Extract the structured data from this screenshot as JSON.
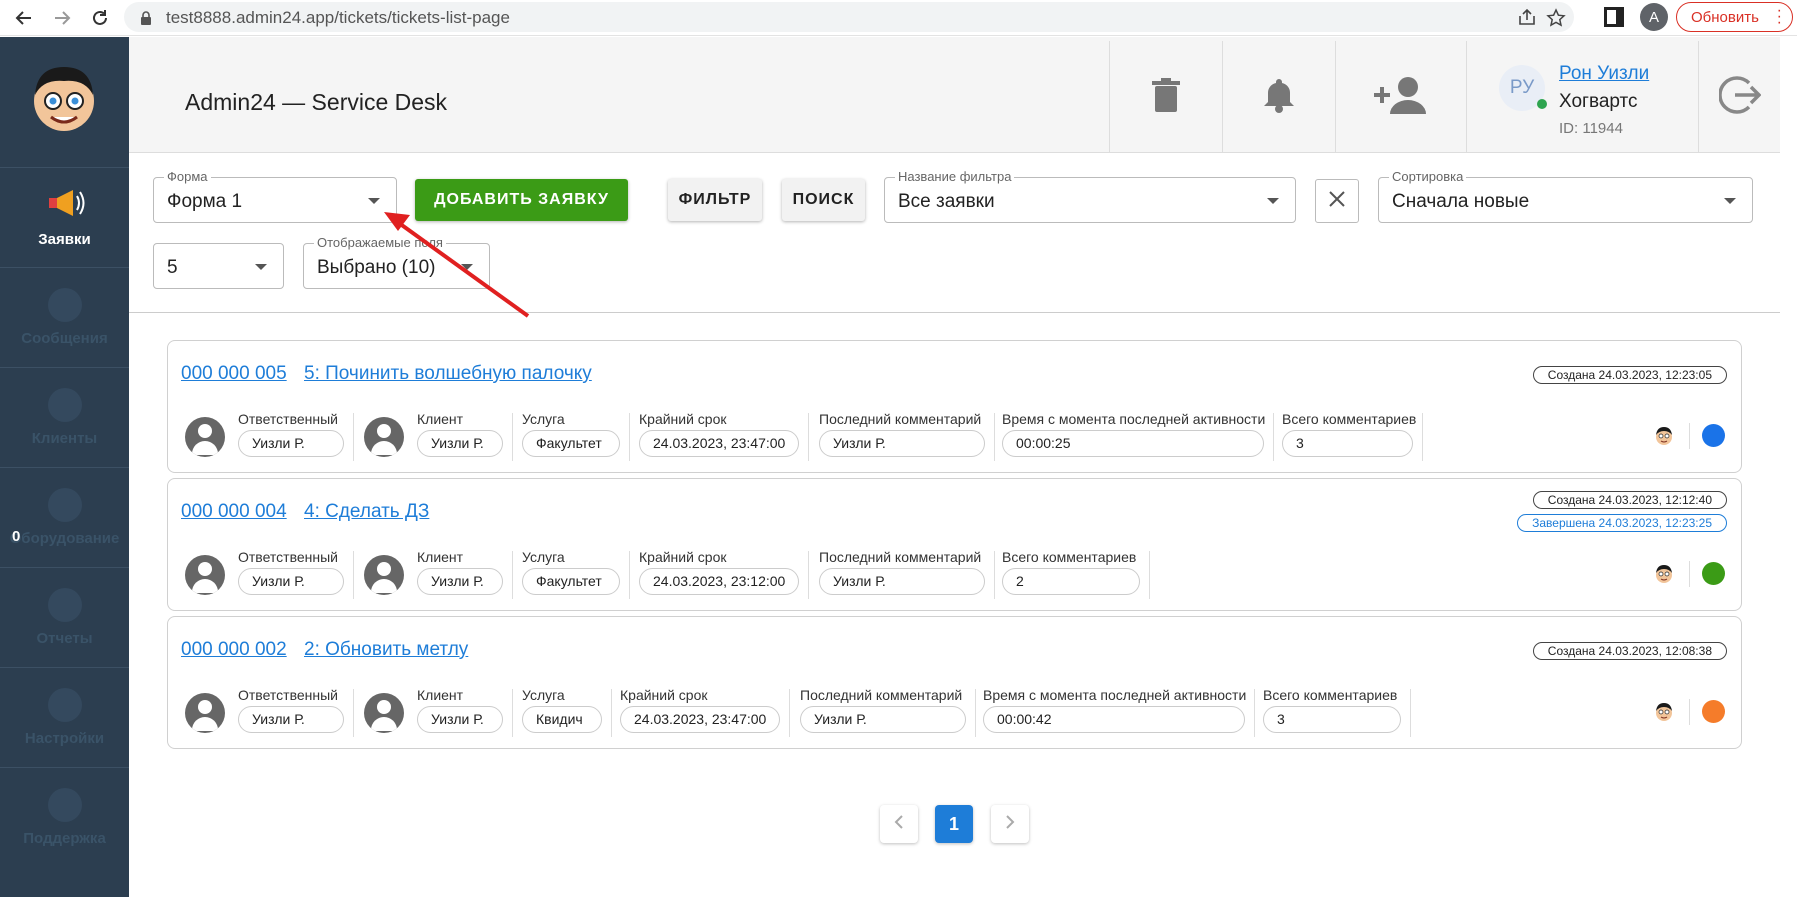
{
  "browser": {
    "url": "test8888.admin24.app/tickets/tickets-list-page",
    "profile_initial": "A",
    "update_label": "Обновить"
  },
  "sidebar": {
    "items": [
      {
        "label": "Заявки",
        "icon": "megaphone-icon",
        "active": true
      },
      {
        "label": "Сообщения",
        "icon": "chat-icon"
      },
      {
        "label": "Клиенты",
        "icon": "users-icon"
      },
      {
        "label": "Оборудование",
        "icon": "equipment-icon"
      },
      {
        "label": "Отчеты",
        "icon": "report-icon"
      },
      {
        "label": "Настройки",
        "icon": "gear-icon"
      },
      {
        "label": "Поддержка",
        "icon": "help-icon"
      }
    ],
    "badge_count": "0"
  },
  "header": {
    "title": "Admin24 — Service Desk",
    "user": {
      "initials": "РУ",
      "name": "Рон Уизли",
      "org": "Хогвартс",
      "id_text": "ID: 11944"
    }
  },
  "toolbar": {
    "form": {
      "label": "Форма",
      "value": "Форма 1"
    },
    "add_button": "ДОБАВИТЬ ЗАЯВКУ",
    "filter_button": "ФИЛЬТР",
    "search_button": "ПОИСК",
    "filter_name": {
      "label": "Название фильтра",
      "value": "Все заявки"
    },
    "sort": {
      "label": "Сортировка",
      "value": "Сначала новые"
    },
    "page_size": {
      "value": "5"
    },
    "fields": {
      "label": "Отображаемые поля",
      "value": "Выбрано (10)"
    }
  },
  "tickets": [
    {
      "number": "000 000 005",
      "title": "5: Починить волшебную палочку",
      "created": "Создана 24.03.2023, 12:23:05",
      "fields": [
        {
          "label": "Ответственный",
          "value": "Уизли Р."
        },
        {
          "label": "Клиент",
          "value": "Уизли Р."
        },
        {
          "label": "Услуга",
          "value": "Факультет"
        },
        {
          "label": "Крайний срок",
          "value": "24.03.2023, 23:47:00"
        },
        {
          "label": "Последний комментарий",
          "value": "Уизли Р."
        },
        {
          "label": "Время с момента последней активности",
          "value": "00:00:25"
        },
        {
          "label": "Всего комментариев",
          "value": "3"
        }
      ],
      "status_color": "#1a73e8"
    },
    {
      "number": "000 000 004",
      "title": "4: Сделать ДЗ",
      "created": "Создана 24.03.2023, 12:12:40",
      "completed": "Завершена 24.03.2023, 12:23:25",
      "fields": [
        {
          "label": "Ответственный",
          "value": "Уизли Р."
        },
        {
          "label": "Клиент",
          "value": "Уизли Р."
        },
        {
          "label": "Услуга",
          "value": "Факультет"
        },
        {
          "label": "Крайний срок",
          "value": "24.03.2023, 23:12:00"
        },
        {
          "label": "Последний комментарий",
          "value": "Уизли Р."
        },
        {
          "label": "Всего комментариев",
          "value": "2"
        }
      ],
      "status_color": "#3b9b16"
    },
    {
      "number": "000 000 002",
      "title": "2: Обновить метлу",
      "created": "Создана 24.03.2023, 12:08:38",
      "fields": [
        {
          "label": "Ответственный",
          "value": "Уизли Р."
        },
        {
          "label": "Клиент",
          "value": "Уизли Р."
        },
        {
          "label": "Услуга",
          "value": "Квидич"
        },
        {
          "label": "Крайний срок",
          "value": "24.03.2023, 23:47:00"
        },
        {
          "label": "Последний комментарий",
          "value": "Уизли Р."
        },
        {
          "label": "Время с момента последней активности",
          "value": "00:00:42"
        },
        {
          "label": "Всего комментариев",
          "value": "3"
        }
      ],
      "status_color": "#f57c2a"
    }
  ],
  "pagination": {
    "current": "1"
  },
  "colors": {
    "sidebar": "#2c3e50",
    "accent": "#1e7dd8",
    "add_button": "#3b9b16",
    "annotation_arrow": "#e02020"
  }
}
